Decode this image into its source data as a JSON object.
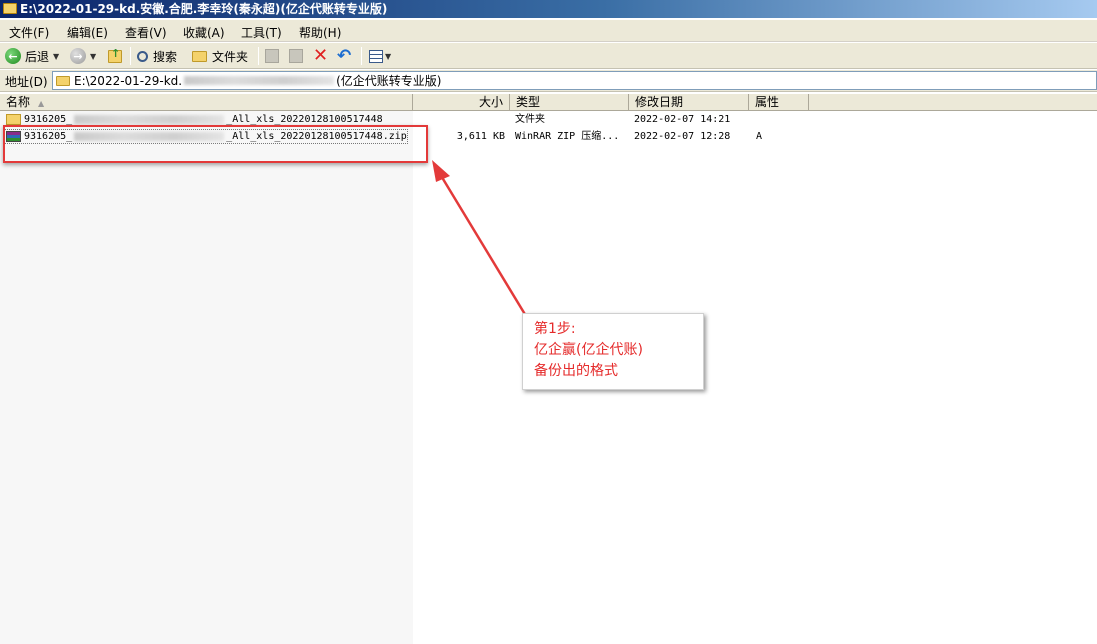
{
  "window": {
    "title": "E:\\2022-01-29-kd.安徽.合肥.李幸玲(秦永超)(亿企代账转专业版)"
  },
  "menu": {
    "items": [
      {
        "label": "文件(F)"
      },
      {
        "label": "编辑(E)"
      },
      {
        "label": "查看(V)"
      },
      {
        "label": "收藏(A)"
      },
      {
        "label": "工具(T)"
      },
      {
        "label": "帮助(H)"
      }
    ]
  },
  "toolbar": {
    "back": "后退",
    "search": "搜索",
    "folders": "文件夹"
  },
  "address": {
    "label": "地址(D)",
    "prefix": "E:\\2022-01-29-kd.",
    "suffix": "(亿企代账转专业版)"
  },
  "columns": {
    "name": "名称",
    "size": "大小",
    "type": "类型",
    "modified": "修改日期",
    "attributes": "属性"
  },
  "files": [
    {
      "icon": "folder-icon",
      "name_prefix": "9316205_",
      "name_suffix": "_All_xls_20220128100517448",
      "size": "",
      "type": "文件夹",
      "modified": "2022-02-07 14:21",
      "attributes": ""
    },
    {
      "icon": "winrar-archive-icon",
      "name_prefix": "9316205_",
      "name_suffix": "_All_xls_20220128100517448.zip",
      "size": "3,611 KB",
      "type": "WinRAR ZIP 压缩...",
      "modified": "2022-02-07 12:28",
      "attributes": "A"
    }
  ],
  "annotation": {
    "line1": "第1步:",
    "line2": "亿企赢(亿企代账)",
    "line3": "备份出的格式"
  },
  "colors": {
    "annotation_red": "#e33a3a",
    "title_start": "#0a246a",
    "title_end": "#a6caf0"
  }
}
